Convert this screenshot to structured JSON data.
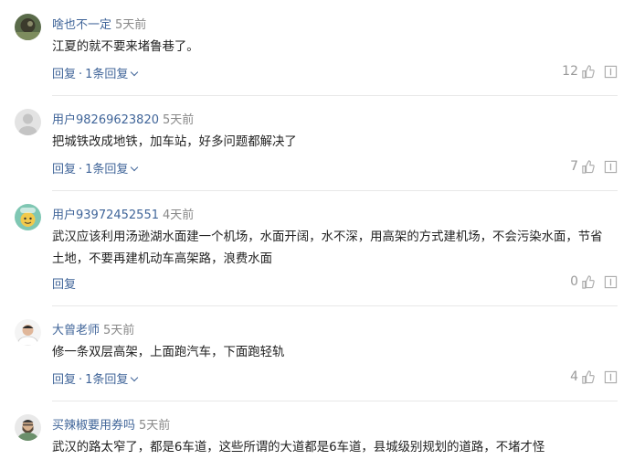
{
  "comments": [
    {
      "username": "啥也不一定",
      "time": "5天前",
      "text": "江夏的就不要来堵鲁巷了。",
      "reply_label": "回复",
      "sep": "·",
      "replies_label": "1条回复",
      "likes": "12",
      "avatar": "photo-avatar"
    },
    {
      "username": "用户98269623820",
      "time": "5天前",
      "text": "把城铁改成地铁，加车站，好多问题都解决了",
      "reply_label": "回复",
      "sep": "·",
      "replies_label": "1条回复",
      "likes": "7",
      "avatar": "default-avatar"
    },
    {
      "username": "用户93972452551",
      "time": "4天前",
      "text": "武汉应该利用汤逊湖水面建一个机场，水面开阔，水不深，用高架的方式建机场，不会污染水面，节省土地，不要再建机动车高架路，浪费水面",
      "reply_label": "回复",
      "likes": "0",
      "avatar": "cartoon-avatar"
    },
    {
      "username": "大曾老师",
      "time": "5天前",
      "text": "修一条双层高架，上面跑汽车，下面跑轻轨",
      "reply_label": "回复",
      "sep": "·",
      "replies_label": "1条回复",
      "likes": "4",
      "avatar": "man-avatar"
    },
    {
      "username": "买辣椒要用券吗",
      "time": "5天前",
      "text": "武汉的路太窄了，都是6车道，这些所谓的大道都是6车道，县城级别规划的道路，不堵才怪",
      "avatar": "bearded-avatar"
    }
  ],
  "colors": {
    "username": "#406599",
    "time": "#888888",
    "text": "#222222",
    "icon": "#999999"
  }
}
